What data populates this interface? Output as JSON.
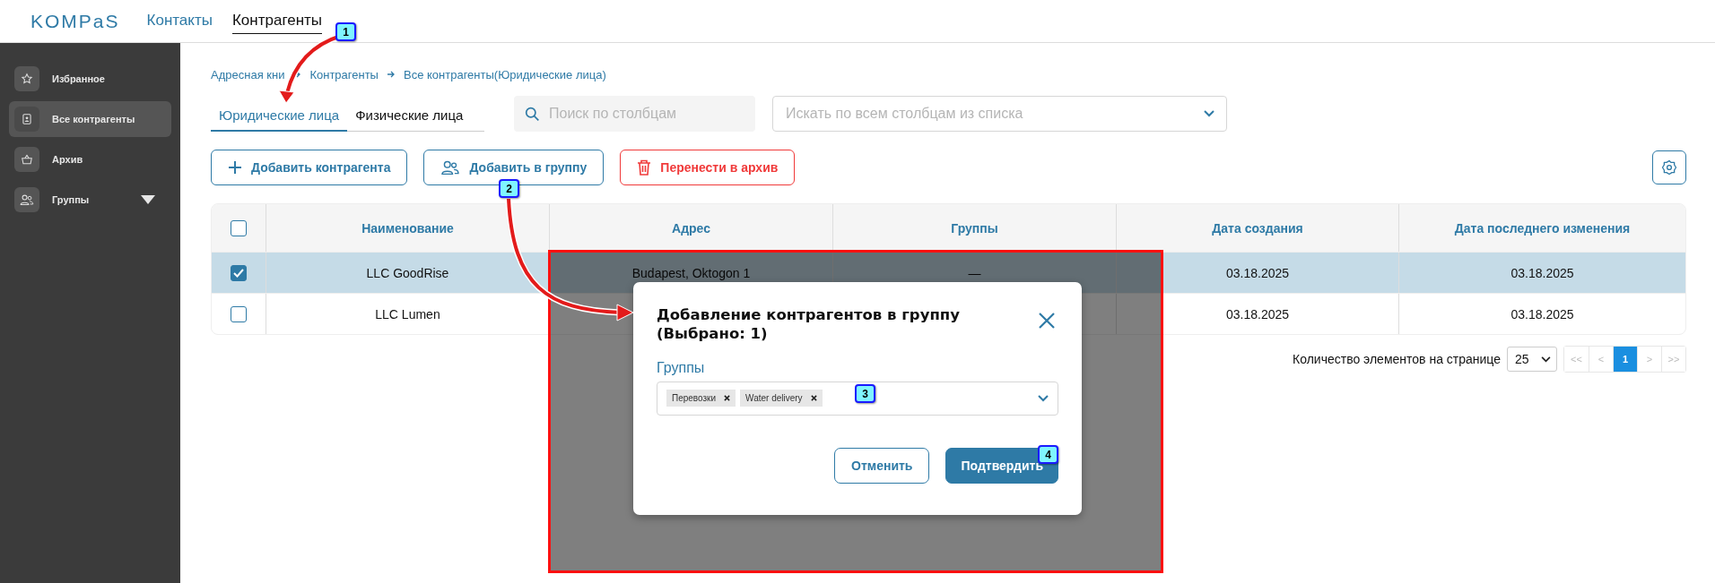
{
  "header": {
    "logo": "KOMPaS",
    "nav": [
      {
        "label": "Контакты",
        "selected": false
      },
      {
        "label": "Контрагенты",
        "selected": true
      }
    ]
  },
  "sidebar": {
    "items": [
      {
        "label": "Избранное",
        "selected": false
      },
      {
        "label": "Все контрагенты",
        "selected": true
      },
      {
        "label": "Архив",
        "selected": false
      },
      {
        "label": "Группы",
        "selected": false,
        "expanded": false
      }
    ]
  },
  "breadcrumb": [
    "Адресная кни",
    "Контрагенты",
    "Все контрагенты(Юридические лица)"
  ],
  "tabs": [
    {
      "label": "Юридические лица",
      "selected": true
    },
    {
      "label": "Физические лица",
      "selected": false
    }
  ],
  "search": {
    "placeholder": "Поиск по столбцам"
  },
  "column_search": {
    "placeholder": "Искать по всем столбцам из списка"
  },
  "actions": [
    {
      "label": "Добавить контрагента",
      "kind": "primary"
    },
    {
      "label": "Добавить в группу",
      "kind": "primary"
    },
    {
      "label": "Перенести в архив",
      "kind": "danger"
    }
  ],
  "table": {
    "all_checked": false,
    "columns": [
      "Наименование",
      "Адрес",
      "Группы",
      "Дата создания",
      "Дата последнего изменения"
    ],
    "rows": [
      {
        "selected": true,
        "checked": true,
        "cells": [
          "LLC GoodRise",
          "Budapest, Oktogon 1",
          "—",
          "03.18.2025",
          "03.18.2025"
        ]
      },
      {
        "selected": false,
        "checked": false,
        "cells": [
          "LLC Lumen",
          null,
          null,
          "03.18.2025",
          "03.18.2025"
        ]
      }
    ]
  },
  "pagination": {
    "label": "Количество элементов на странице",
    "page_size": "25",
    "pages": [
      {
        "label": "<<",
        "selected": false,
        "disabled": true
      },
      {
        "label": "<",
        "selected": false,
        "disabled": true
      },
      {
        "label": "1",
        "selected": true,
        "disabled": false
      },
      {
        "label": ">",
        "selected": false,
        "disabled": true
      },
      {
        "label": ">>",
        "selected": false,
        "disabled": true
      }
    ]
  },
  "dialog": {
    "title": "Добавление контрагентов в группу (Выбрано: 1)",
    "field_label": "Группы",
    "tags": [
      "Перевозки",
      "Water delivery"
    ],
    "buttons": [
      {
        "label": "Отменить",
        "kind": "secondary"
      },
      {
        "label": "Подтвердить",
        "kind": "primary"
      }
    ]
  },
  "callouts": [
    "1",
    "2",
    "3",
    "4"
  ]
}
